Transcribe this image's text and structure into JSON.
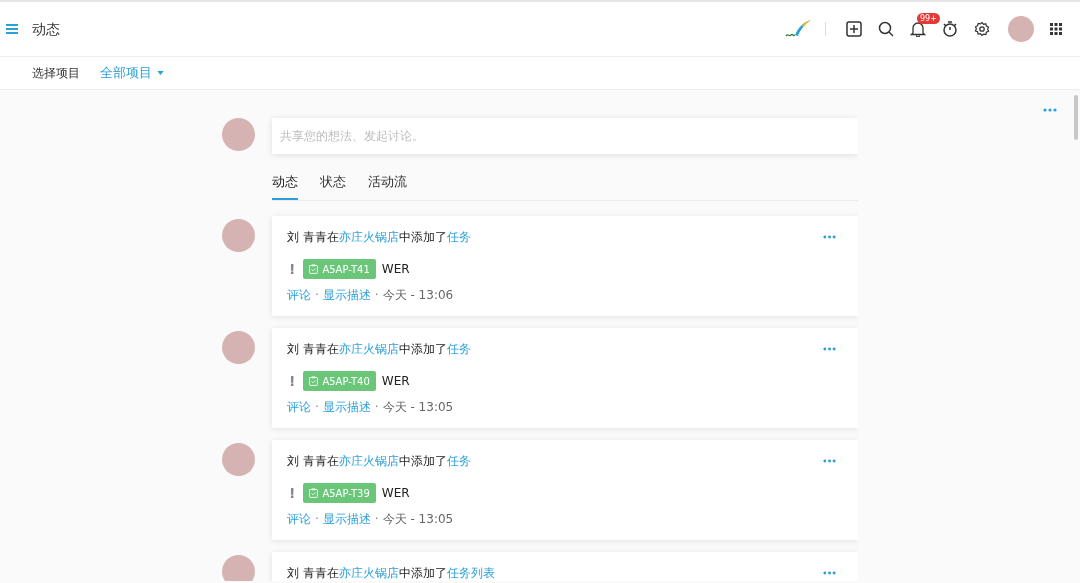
{
  "header": {
    "title": "动态",
    "notification_badge": "99+"
  },
  "filter": {
    "label": "选择项目",
    "value": "全部项目"
  },
  "composer": {
    "placeholder": "共享您的想法、发起讨论。"
  },
  "tabs": [
    {
      "label": "动态",
      "selected": true
    },
    {
      "label": "状态",
      "selected": false
    },
    {
      "label": "活动流",
      "selected": false
    }
  ],
  "separator": "·",
  "feed": [
    {
      "actor": "刘 青青",
      "in": "在",
      "project": "亦庄火锅店",
      "action": "中添加了",
      "object": "任务",
      "task": {
        "priority": "!",
        "tag": "A5AP-T41",
        "title": "WER"
      },
      "links": [
        "评论",
        "显示描述"
      ],
      "time": "今天 - 13:06"
    },
    {
      "actor": "刘 青青",
      "in": "在",
      "project": "亦庄火锅店",
      "action": "中添加了",
      "object": "任务",
      "task": {
        "priority": "!",
        "tag": "A5AP-T40",
        "title": "WER"
      },
      "links": [
        "评论",
        "显示描述"
      ],
      "time": "今天 - 13:05"
    },
    {
      "actor": "刘 青青",
      "in": "在",
      "project": "亦庄火锅店",
      "action": "中添加了",
      "object": "任务",
      "task": {
        "priority": "!",
        "tag": "A5AP-T39",
        "title": "WER"
      },
      "links": [
        "评论",
        "显示描述"
      ],
      "time": "今天 - 13:05"
    },
    {
      "actor": "刘 青青",
      "in": "在",
      "project": "亦庄火锅店",
      "action": "中添加了",
      "object": "任务列表"
    }
  ]
}
